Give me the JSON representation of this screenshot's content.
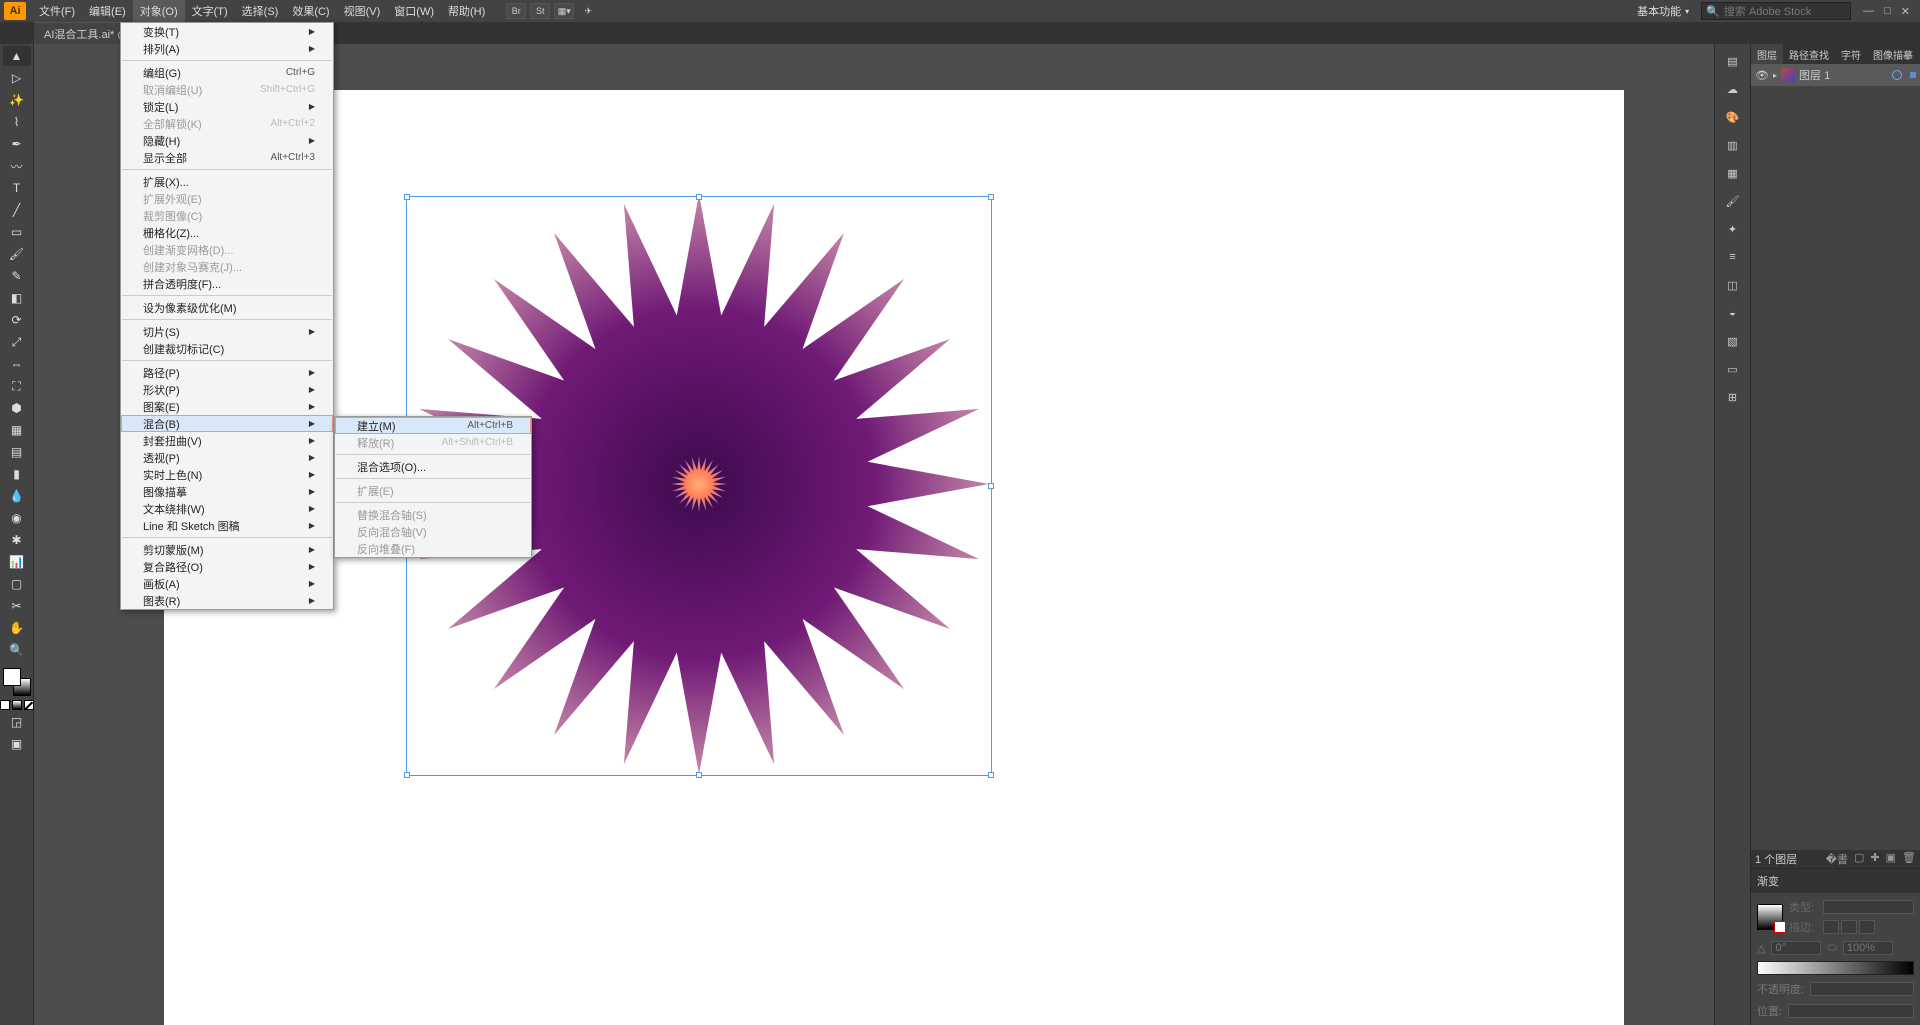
{
  "app": {
    "logo": "Ai",
    "doc_tab": "AI混合工具.ai* @"
  },
  "menus": {
    "file": "文件(F)",
    "edit": "编辑(E)",
    "object": "对象(O)",
    "type": "文字(T)",
    "select": "选择(S)",
    "effect": "效果(C)",
    "view": "视图(V)",
    "window": "窗口(W)",
    "help": "帮助(H)"
  },
  "topright": {
    "workspace": "基本功能",
    "stock_placeholder": "搜索 Adobe Stock"
  },
  "object_menu": {
    "transform": "变换(T)",
    "arrange": "排列(A)",
    "group": "编组(G)",
    "group_sc": "Ctrl+G",
    "ungroup": "取消编组(U)",
    "ungroup_sc": "Shift+Ctrl+G",
    "lock": "锁定(L)",
    "unlock_all": "全部解锁(K)",
    "unlock_all_sc": "Alt+Ctrl+2",
    "hide": "隐藏(H)",
    "show_all": "显示全部",
    "show_all_sc": "Alt+Ctrl+3",
    "expand": "扩展(X)...",
    "expand_app": "扩展外观(E)",
    "crop_image": "裁剪图像(C)",
    "rasterize": "栅格化(Z)...",
    "mesh": "创建渐变网格(D)...",
    "mosaic": "创建对象马赛克(J)...",
    "flatten": "拼合透明度(F)...",
    "pixel_perfect": "设为像素级优化(M)",
    "slice": "切片(S)",
    "trim_marks": "创建裁切标记(C)",
    "path": "路径(P)",
    "shape": "形状(P)",
    "pattern": "图案(E)",
    "blend": "混合(B)",
    "envelope": "封套扭曲(V)",
    "perspective": "透视(P)",
    "live_paint": "实时上色(N)",
    "image_trace": "图像描摹",
    "text_wrap": "文本绕排(W)",
    "line_sketch": "Line 和 Sketch 图稿",
    "clip_mask": "剪切蒙版(M)",
    "compound": "复合路径(O)",
    "artboards": "画板(A)",
    "graph": "图表(R)"
  },
  "blend_menu": {
    "make": "建立(M)",
    "make_sc": "Alt+Ctrl+B",
    "release": "释放(R)",
    "release_sc": "Alt+Shift+Ctrl+B",
    "options": "混合选项(O)...",
    "expand": "扩展(E)",
    "replace_spine": "替换混合轴(S)",
    "reverse_spine": "反向混合轴(V)",
    "reverse_front": "反向堆叠(F)"
  },
  "panel_tabs": {
    "layers": "图层",
    "path": "路径查找",
    "char": "字符",
    "img": "图像描摹"
  },
  "layer": {
    "name": "图层 1",
    "count": "1 个图层"
  },
  "gradient": {
    "title": "渐变",
    "type_label": "类型:",
    "stroke_label": "描边:",
    "angle_icon": "△",
    "angle_val": "0°",
    "ratio_icon": "⬭",
    "ratio_val": "100%",
    "opacity_label": "不透明度:",
    "position_label": "位置:"
  }
}
